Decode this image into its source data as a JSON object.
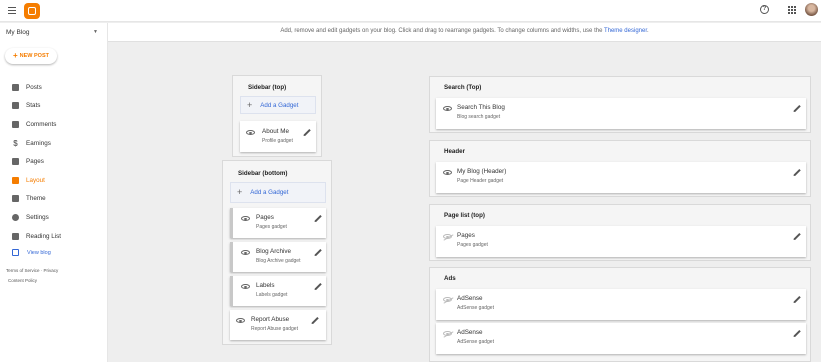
{
  "colors": {
    "accent": "#f57d00",
    "link": "#3367d6",
    "background": "#eeeeee"
  },
  "header": {
    "menu_icon": "hamburger-icon",
    "logo_icon": "blogger-logo-icon",
    "help_icon": "help-circle-icon",
    "apps_icon": "apps-grid-icon",
    "avatar": "user-avatar"
  },
  "sidebar": {
    "blog_name": "My Blog",
    "new_post": "NEW POST",
    "items": [
      {
        "label": "Posts",
        "icon": "posts-icon"
      },
      {
        "label": "Stats",
        "icon": "stats-icon"
      },
      {
        "label": "Comments",
        "icon": "comments-icon"
      },
      {
        "label": "Earnings",
        "icon": "dollar-icon"
      },
      {
        "label": "Pages",
        "icon": "pages-icon"
      },
      {
        "label": "Layout",
        "icon": "layout-icon",
        "active": true
      },
      {
        "label": "Theme",
        "icon": "theme-icon"
      },
      {
        "label": "Settings",
        "icon": "gear-icon"
      },
      {
        "label": "Reading List",
        "icon": "bookmark-icon"
      }
    ],
    "view_blog": "View blog",
    "terms": "Terms of Service",
    "separator": "·",
    "privacy": "Privacy",
    "content_policy": "Content Policy"
  },
  "notice": {
    "text": "Add, remove and edit gadgets on your blog. Click and drag to rearrange gadgets. To change columns and widths, use the ",
    "link": "Theme designer",
    "end": "."
  },
  "sections": {
    "sidebar_top": {
      "title": "Sidebar (top)",
      "add_label": "Add a Gadget",
      "gadgets": [
        {
          "name": "About Me",
          "type": "Profile gadget"
        }
      ]
    },
    "sidebar_bottom": {
      "title": "Sidebar (bottom)",
      "add_label": "Add a Gadget",
      "gadgets": [
        {
          "name": "Pages",
          "type": "Pages gadget"
        },
        {
          "name": "Blog Archive",
          "type": "Blog Archive gadget"
        },
        {
          "name": "Labels",
          "type": "Labels gadget"
        },
        {
          "name": "Report Abuse",
          "type": "Report Abuse gadget"
        }
      ]
    },
    "search_top": {
      "title": "Search (Top)",
      "gadgets": [
        {
          "name": "Search This Blog",
          "type": "Blog search gadget"
        }
      ]
    },
    "header": {
      "title": "Header",
      "gadgets": [
        {
          "name": "My Blog (Header)",
          "type": "Page Header gadget"
        }
      ]
    },
    "page_list_top": {
      "title": "Page list (top)",
      "gadgets": [
        {
          "name": "Pages",
          "type": "Pages gadget"
        }
      ]
    },
    "ads": {
      "title": "Ads",
      "gadgets": [
        {
          "name": "AdSense",
          "type": "AdSense gadget"
        },
        {
          "name": "AdSense",
          "type": "AdSense gadget"
        }
      ]
    }
  }
}
